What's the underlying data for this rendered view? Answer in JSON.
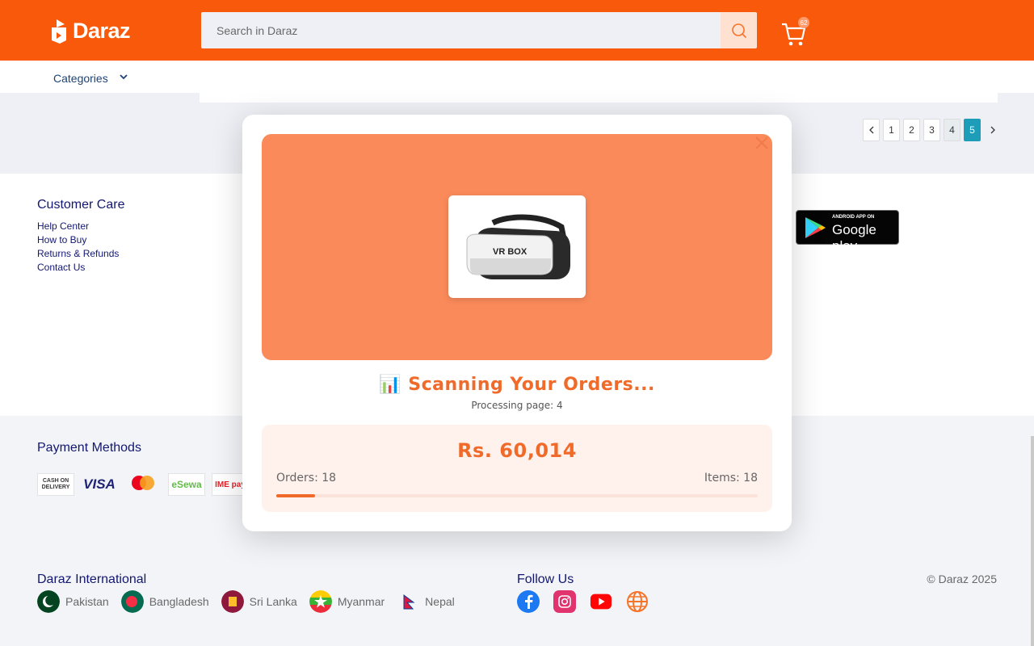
{
  "header": {
    "logo_text": "Daraz",
    "search_placeholder": "Search in Daraz",
    "cart_count": "62"
  },
  "category_bar": {
    "label": "Categories"
  },
  "pagination": {
    "pages": [
      "1",
      "2",
      "3",
      "4",
      "5"
    ],
    "active": "5"
  },
  "customer_care": {
    "title": "Customer Care",
    "links": [
      "Help Center",
      "How to Buy",
      "Returns & Refunds",
      "Contact Us"
    ]
  },
  "app_badge": {
    "small": "ANDROID APP ON",
    "big": "Google play"
  },
  "payment": {
    "title": "Payment Methods",
    "methods": [
      "CASH ON DELIVERY",
      "VISA",
      "mastercard",
      "eSewa",
      "IME pay"
    ]
  },
  "international": {
    "title": "Daraz International",
    "countries": [
      "Pakistan",
      "Bangladesh",
      "Sri Lanka",
      "Myanmar",
      "Nepal"
    ]
  },
  "follow": {
    "title": "Follow Us",
    "icons": [
      "facebook-icon",
      "instagram-icon",
      "youtube-icon",
      "globe-icon"
    ]
  },
  "copyright": "© Daraz 2025",
  "modal": {
    "product_label": "VR BOX",
    "title_emoji": "📊",
    "title": "Scanning Your Orders...",
    "subtitle": "Processing page: 4",
    "amount": "Rs. 60,014",
    "orders": "Orders: 18",
    "items": "Items: 18",
    "progress_fraction": 0.08
  },
  "colors": {
    "brand": "#f85606",
    "accent": "#f06a2a",
    "link": "#0f136d",
    "active_page": "#1a9cb7"
  }
}
